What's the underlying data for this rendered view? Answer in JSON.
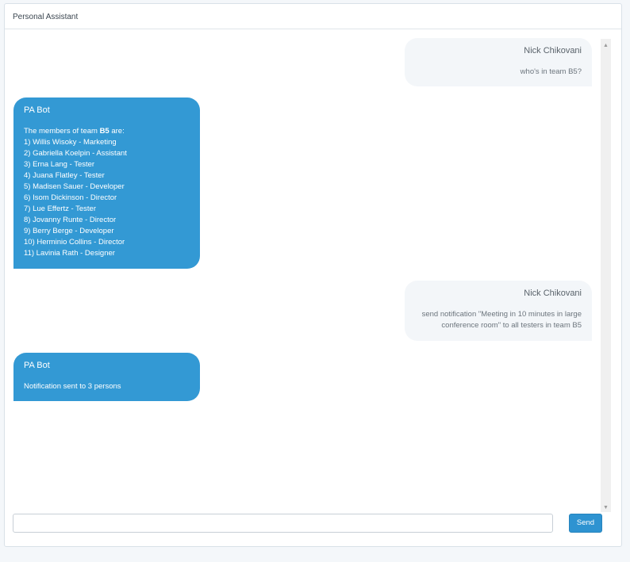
{
  "panel": {
    "title": "Personal Assistant"
  },
  "messages": [
    {
      "from": "user",
      "sender": "Nick Chikovani",
      "lines": [
        "who's in team B5?"
      ]
    },
    {
      "from": "bot",
      "sender": "PA Bot",
      "intro_prefix": "The members of team ",
      "intro_team": "B5",
      "intro_suffix": " are:",
      "lines": [
        "1) Willis Wisoky - Marketing",
        "2) Gabriella Koelpin - Assistant",
        "3) Erna Lang - Tester",
        "4) Juana Flatley - Tester",
        "5) Madisen Sauer - Developer",
        "6) Isom Dickinson - Director",
        "7) Lue Effertz - Tester",
        "8) Jovanny Runte - Director",
        "9) Berry Berge - Developer",
        "10) Herminio Collins - Director",
        "11) Lavinia Rath - Designer"
      ]
    },
    {
      "from": "user",
      "sender": "Nick Chikovani",
      "lines": [
        "send notification \"Meeting in 10 minutes in large",
        "conference room\" to all testers in team B5"
      ]
    },
    {
      "from": "bot",
      "sender": "PA Bot",
      "lines": [
        "Notification sent to 3 persons"
      ]
    }
  ],
  "composer": {
    "input_value": "",
    "input_placeholder": "",
    "send_label": "Send"
  },
  "colors": {
    "bot_bubble": "#3399d4",
    "user_bubble": "#f3f6f9",
    "send_button": "#2e93d1"
  }
}
